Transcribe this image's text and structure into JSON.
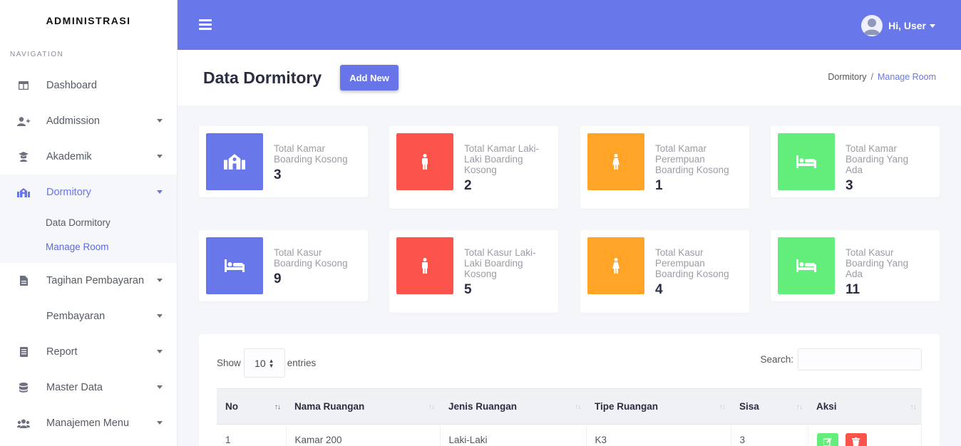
{
  "sidebar": {
    "brand": "ADMINISTRASI",
    "heading": "NAVIGATION",
    "items": [
      {
        "label": "Dashboard"
      },
      {
        "label": "Addmission"
      },
      {
        "label": "Akademik"
      },
      {
        "label": "Dormitory"
      },
      {
        "label": "Tagihan Pembayaran"
      },
      {
        "label": "Pembayaran"
      },
      {
        "label": "Report"
      },
      {
        "label": "Master Data"
      },
      {
        "label": "Manajemen Menu"
      }
    ],
    "dormitory_sub": [
      {
        "label": "Data Dormitory"
      },
      {
        "label": "Manage Room"
      }
    ]
  },
  "topbar": {
    "user_label": "Hi, User"
  },
  "header": {
    "title": "Data Dormitory",
    "add_button": "Add New",
    "breadcrumb": {
      "parent": "Dormitory",
      "separator": "/",
      "current": "Manage Room"
    }
  },
  "stats": [
    {
      "label": "Total Kamar Boarding Kosong",
      "value": "3",
      "color": "#6877e9",
      "icon": "school-building-icon"
    },
    {
      "label": "Total Kamar Laki-Laki Boarding Kosong",
      "value": "2",
      "color": "#fc544b",
      "icon": "male-icon"
    },
    {
      "label": "Total Kamar Perempuan Boarding Kosong",
      "value": "1",
      "color": "#ffa426",
      "icon": "female-icon"
    },
    {
      "label": "Total Kamar Boarding Yang Ada",
      "value": "3",
      "color": "#63ed7a",
      "icon": "bed-icon"
    },
    {
      "label": "Total Kasur Boarding Kosong",
      "value": "9",
      "color": "#6877e9",
      "icon": "bed-icon"
    },
    {
      "label": "Total Kasur Laki-Laki Boarding Kosong",
      "value": "5",
      "color": "#fc544b",
      "icon": "male-icon"
    },
    {
      "label": "Total Kasur Perempuan Boarding Kosong",
      "value": "4",
      "color": "#ffa426",
      "icon": "female-icon"
    },
    {
      "label": "Total Kasur Boarding Yang Ada",
      "value": "11",
      "color": "#63ed7a",
      "icon": "bed-icon"
    }
  ],
  "table": {
    "show_label": "Show",
    "entries_value": "10",
    "entries_label": "entries",
    "search_label": "Search:",
    "columns": [
      "No",
      "Nama Ruangan",
      "Jenis Ruangan",
      "Tipe Ruangan",
      "Sisa",
      "Aksi"
    ],
    "rows": [
      {
        "no": "1",
        "nama": "Kamar 200",
        "jenis": "Laki-Laki",
        "tipe": "K3",
        "sisa": "3"
      }
    ]
  }
}
